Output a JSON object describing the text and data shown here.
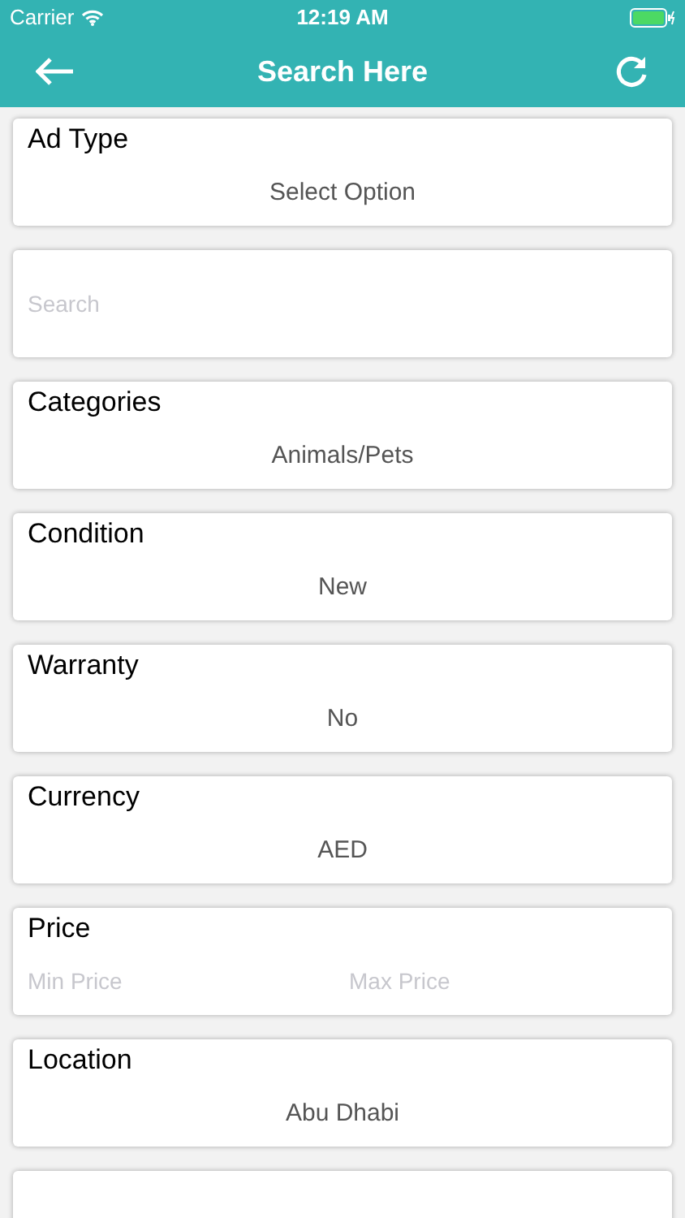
{
  "status_bar": {
    "carrier": "Carrier",
    "time": "12:19 AM"
  },
  "nav": {
    "title": "Search Here"
  },
  "fields": [
    {
      "kind": "select",
      "label": "Ad Type",
      "value": "Select Option"
    },
    {
      "kind": "search",
      "placeholder": "Search"
    },
    {
      "kind": "select",
      "label": "Categories",
      "value": "Animals/Pets"
    },
    {
      "kind": "select",
      "label": "Condition",
      "value": "New"
    },
    {
      "kind": "select",
      "label": "Warranty",
      "value": "No"
    },
    {
      "kind": "select",
      "label": "Currency",
      "value": "AED"
    },
    {
      "kind": "range",
      "label": "Price",
      "min_placeholder": "Min Price",
      "max_placeholder": "Max Price"
    },
    {
      "kind": "select",
      "label": "Location",
      "value": "Abu Dhabi"
    },
    {
      "kind": "blank"
    }
  ]
}
